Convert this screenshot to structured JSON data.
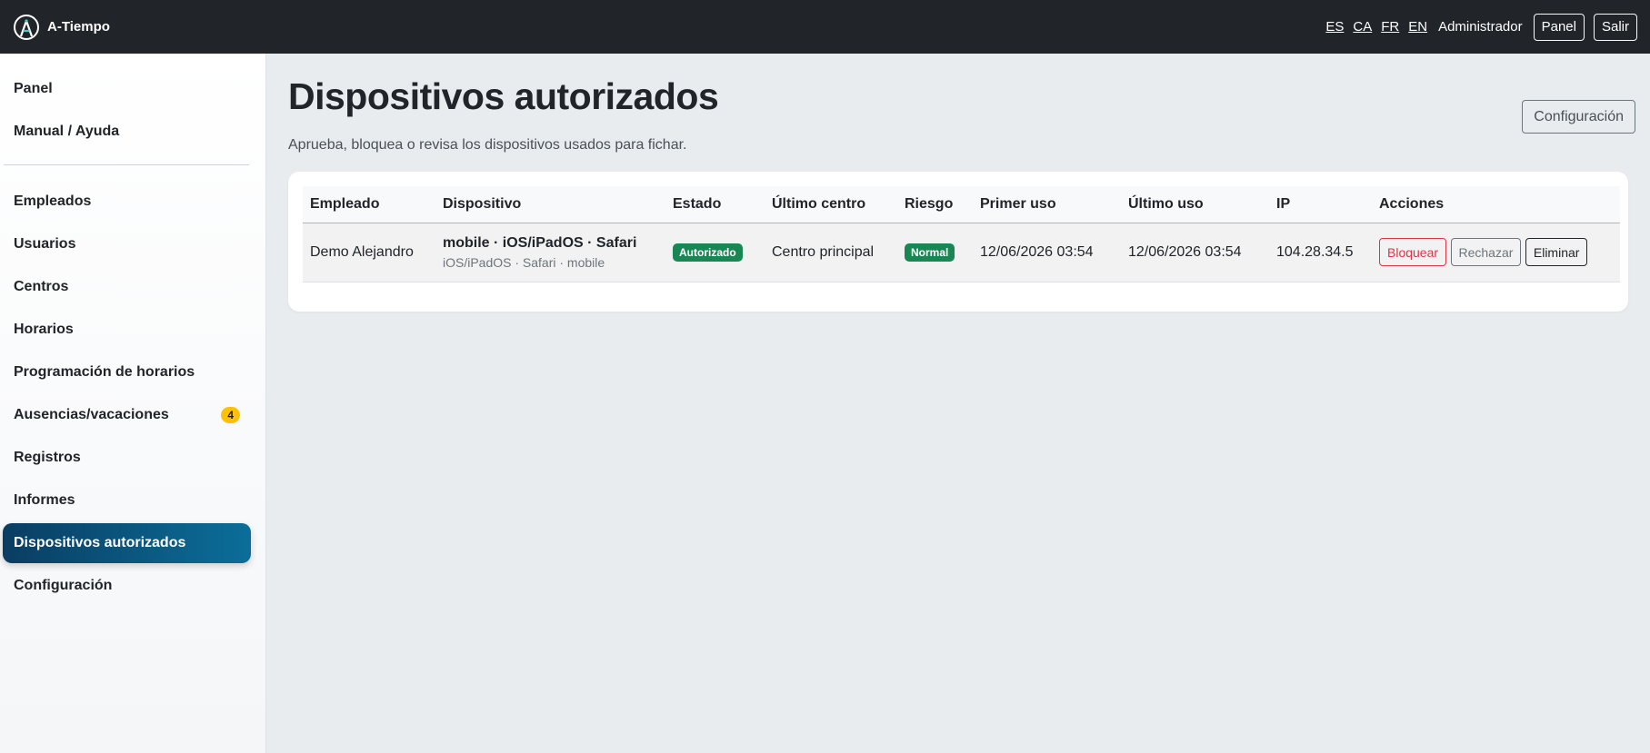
{
  "app": {
    "name": "A-Tiempo"
  },
  "topbar": {
    "languages": [
      "ES",
      "CA",
      "FR",
      "EN"
    ],
    "user": "Administrador",
    "panel_label": "Panel",
    "logout_label": "Salir"
  },
  "sidebar": {
    "top_items": [
      {
        "label": "Panel"
      },
      {
        "label": "Manual / Ayuda"
      }
    ],
    "items": [
      {
        "label": "Empleados"
      },
      {
        "label": "Usuarios"
      },
      {
        "label": "Centros"
      },
      {
        "label": "Horarios"
      },
      {
        "label": "Programación de horarios"
      },
      {
        "label": "Ausencias/vacaciones",
        "badge": "4"
      },
      {
        "label": "Registros"
      },
      {
        "label": "Informes"
      },
      {
        "label": "Dispositivos autorizados",
        "active": true
      },
      {
        "label": "Configuración"
      }
    ]
  },
  "page": {
    "title": "Dispositivos autorizados",
    "subtitle": "Aprueba, bloquea o revisa los dispositivos usados para fichar.",
    "config_button": "Configuración"
  },
  "table": {
    "headers": [
      "Empleado",
      "Dispositivo",
      "Estado",
      "Último centro",
      "Riesgo",
      "Primer uso",
      "Último uso",
      "IP",
      "Acciones"
    ],
    "rows": [
      {
        "employee": "Demo Alejandro",
        "device_main": "mobile · iOS/iPadOS · Safari",
        "device_sub": "iOS/iPadOS · Safari · mobile",
        "status": "Autorizado",
        "last_center": "Centro principal",
        "risk": "Normal",
        "first_use": "12/06/2026 03:54",
        "last_use": "12/06/2026 03:54",
        "ip": "104.28.34.5",
        "actions": {
          "block": "Bloquear",
          "reject": "Rechazar",
          "delete": "Eliminar"
        }
      }
    ]
  },
  "colors": {
    "topbar": "#212529",
    "active_nav_start": "#0a3d62",
    "active_nav_end": "#0b6e99",
    "badge": "#ffc107",
    "success": "#198754",
    "danger": "#dc3545"
  }
}
